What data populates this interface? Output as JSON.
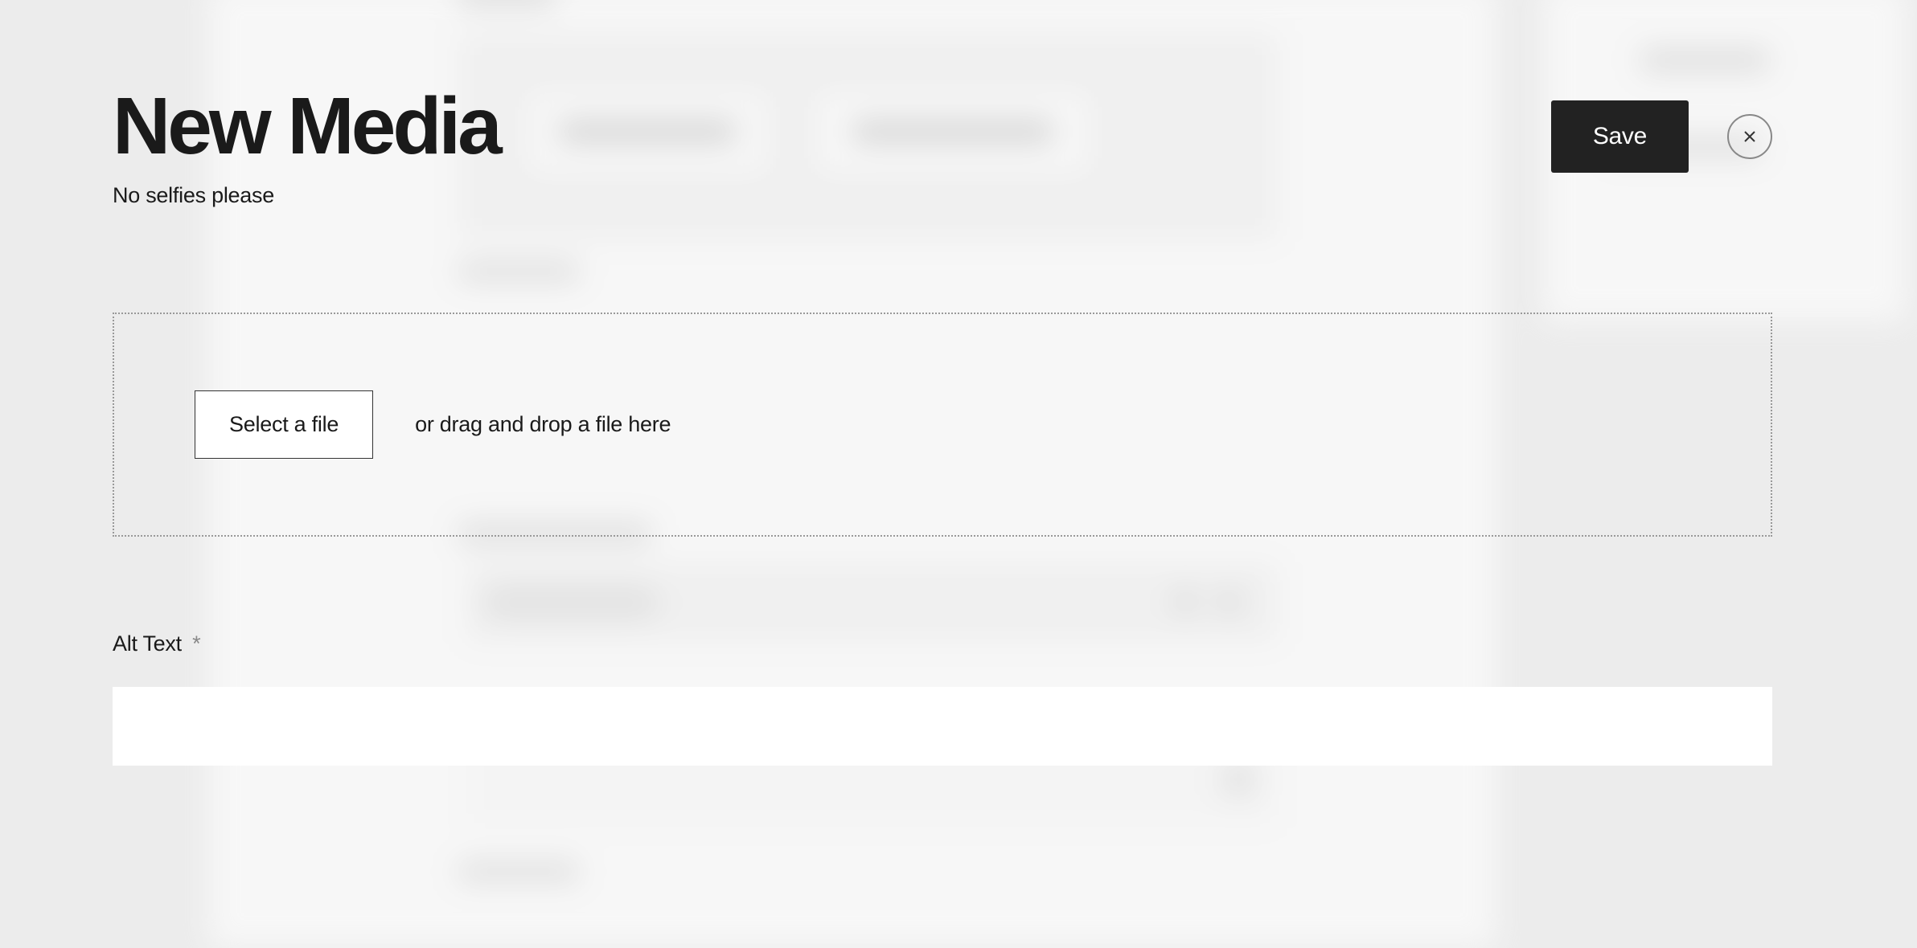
{
  "modal": {
    "title": "New Media",
    "subtitle": "No selfies please",
    "save_label": "Save"
  },
  "dropzone": {
    "select_label": "Select a file",
    "hint": "or drag and drop a file here"
  },
  "fields": {
    "alt_text": {
      "label": "Alt Text",
      "required_marker": "*",
      "value": ""
    }
  }
}
